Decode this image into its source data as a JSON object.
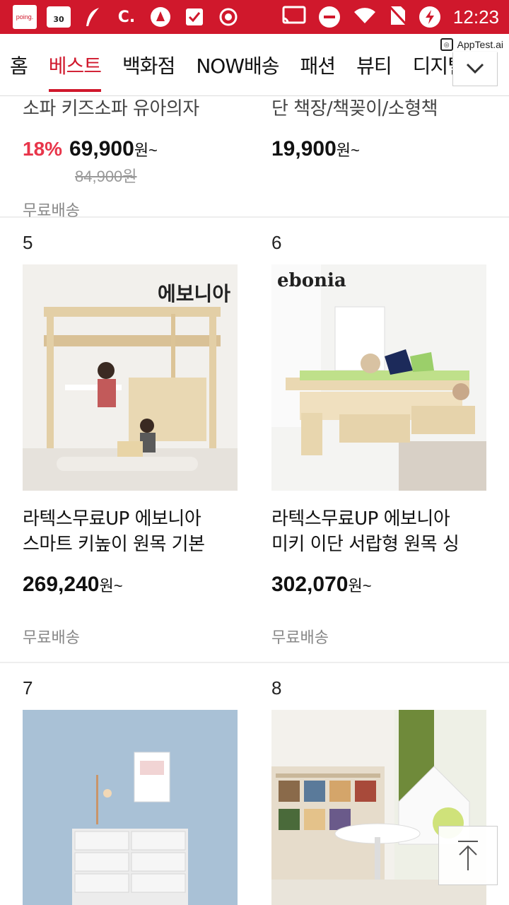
{
  "status_bar": {
    "app_badge": "poing.",
    "calendar_day": "30",
    "c_icon": "C.",
    "time": "12:23"
  },
  "tabs": [
    {
      "label": "홈",
      "active": false
    },
    {
      "label": "베스트",
      "active": true
    },
    {
      "label": "백화점",
      "active": false
    },
    {
      "label": "NOW배송",
      "active": false
    },
    {
      "label": "패션",
      "active": false
    },
    {
      "label": "뷰티",
      "active": false
    },
    {
      "label": "디지털",
      "active": false
    }
  ],
  "watermark": "AppTest.ai",
  "products_top": [
    {
      "name": "소파 키즈소파 유아의자",
      "discount": "18%",
      "price": "69,900",
      "won": "원~",
      "original": "84,900원",
      "shipping": "무료배송"
    },
    {
      "name": "단 책장/책꽂이/소형책",
      "discount": "",
      "price": "19,900",
      "won": "원~",
      "original": "",
      "shipping": ""
    }
  ],
  "products": [
    {
      "rank": "5",
      "brand": "에보니아",
      "name_line1": "라텍스무료UP  에보니아",
      "name_line2": "스마트 키높이 원목 기본",
      "price": "269,240",
      "won": "원~",
      "shipping": "무료배송"
    },
    {
      "rank": "6",
      "brand": "ebonia",
      "name_line1": "라텍스무료UP  에보니아",
      "name_line2": "미키 이단 서랍형 원목 싱",
      "price": "302,070",
      "won": "원~",
      "shipping": "무료배송"
    },
    {
      "rank": "7"
    },
    {
      "rank": "8"
    }
  ],
  "colors": {
    "brand_red": "#d0182c",
    "discount_red": "#e8354a"
  },
  "icons": {
    "more": "chevron-down-icon",
    "scroll_top": "arrow-up-icon"
  }
}
